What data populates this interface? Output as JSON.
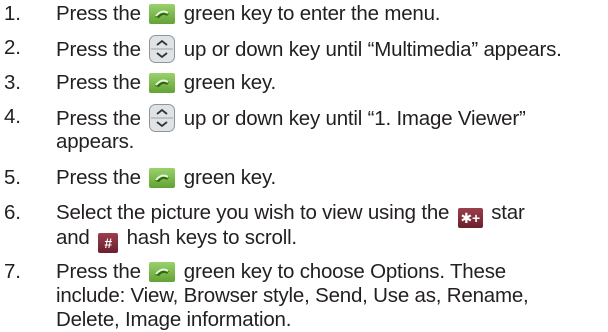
{
  "steps": [
    {
      "num": "1.",
      "pre": "Press the",
      "icon": "green-call-key-icon",
      "post": "green key to enter the menu."
    },
    {
      "num": "2.",
      "pre": "Press the",
      "icon": "up-down-navigation-key-icon",
      "post": "up or down key until “Multimedia” appears."
    },
    {
      "num": "3.",
      "pre": "Press the",
      "icon": "green-call-key-icon",
      "post": "green key."
    },
    {
      "num": "4.",
      "pre": "Press the",
      "icon": "up-down-navigation-key-icon",
      "post": "up or down key until “1. Image Viewer”",
      "line2": "appears."
    },
    {
      "num": "5.",
      "pre": "Press the",
      "icon": "green-call-key-icon",
      "post": "green key."
    },
    {
      "num": "6.",
      "pre": "Select the picture you wish to view using the",
      "icon": "star-key-icon",
      "post": "star",
      "line2_icon": "hash-key-icon",
      "line2": "hash keys to scroll.",
      "line2_pre": "and"
    },
    {
      "num": "7.",
      "pre": "Press the",
      "icon": "green-call-key-icon",
      "post": "green key to choose Options. These",
      "line2": "include: View, Browser style, Send, Use as, Rename,",
      "line3": "Delete, Image information."
    }
  ],
  "key_glyphs": {
    "star": "✱+",
    "hash": "#"
  }
}
